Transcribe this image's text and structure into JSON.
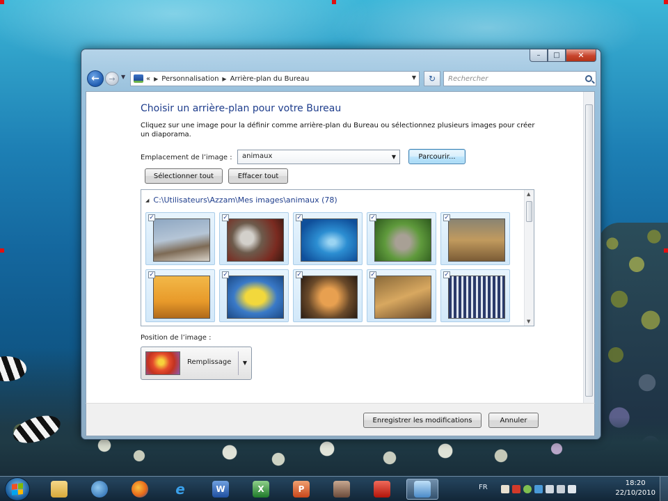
{
  "window": {
    "breadcrumb_chevrons": "«",
    "breadcrumb": [
      "Personnalisation",
      "Arrière-plan du Bureau"
    ],
    "search_placeholder": "Rechercher",
    "min_glyph": "–",
    "max_glyph": "□",
    "close_glyph": "✕"
  },
  "page": {
    "title": "Choisir un arrière-plan pour votre Bureau",
    "description": "Cliquez sur une image pour la définir comme arrière-plan du Bureau ou sélectionnez plusieurs images pour créer un diaporama.",
    "location_label": "Emplacement de l’image :",
    "location_value": "animaux",
    "browse_button": "Parcourir...",
    "select_all_button": "Sélectionner tout",
    "clear_all_button": "Effacer tout",
    "gallery_path": "C:\\Utilisateurs\\Azzam\\Mes images\\animaux (78)",
    "position_label": "Position de l’image :",
    "position_value": "Remplissage",
    "save_button": "Enregistrer les modifications",
    "cancel_button": "Annuler"
  },
  "gallery": {
    "thumbnails": [
      {
        "name": "eagle",
        "checked": true
      },
      {
        "name": "wolf",
        "checked": true
      },
      {
        "name": "shark",
        "checked": true
      },
      {
        "name": "koala",
        "checked": true
      },
      {
        "name": "tigers",
        "checked": true
      },
      {
        "name": "horse",
        "checked": true
      },
      {
        "name": "fish",
        "checked": true
      },
      {
        "name": "tiger",
        "checked": true
      },
      {
        "name": "tiger-cubs",
        "checked": true
      },
      {
        "name": "birds",
        "checked": true
      }
    ]
  },
  "taskbar": {
    "apps": [
      {
        "name": "explorer-icon",
        "glyph": ""
      },
      {
        "name": "thunderbird-icon",
        "glyph": ""
      },
      {
        "name": "firefox-icon",
        "glyph": ""
      },
      {
        "name": "internet-explorer-icon",
        "glyph": "e"
      },
      {
        "name": "word-icon",
        "glyph": "W"
      },
      {
        "name": "excel-icon",
        "glyph": "X"
      },
      {
        "name": "powerpoint-icon",
        "glyph": "P"
      },
      {
        "name": "video-editor-icon",
        "glyph": ""
      },
      {
        "name": "acrobat-icon",
        "glyph": ""
      },
      {
        "name": "personalization-icon",
        "glyph": ""
      }
    ],
    "language": "FR",
    "time": "18:20",
    "date": "22/10/2010"
  },
  "colors": {
    "title_blue": "#1e3d8c",
    "close_red": "#c7442c",
    "selection_blue": "#d2e8f9"
  }
}
